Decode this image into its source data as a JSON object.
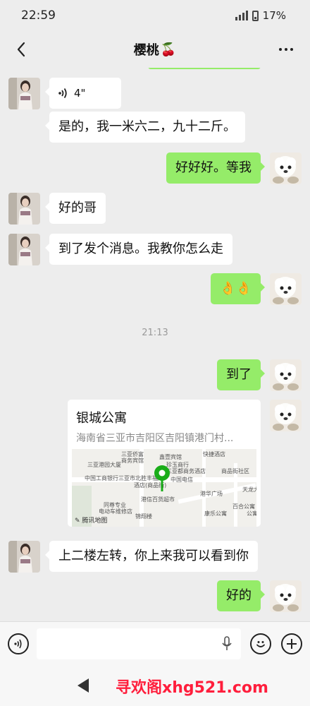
{
  "status": {
    "time": "22:59",
    "battery": "17%"
  },
  "nav": {
    "title": "樱桃",
    "title_emoji": "🍒"
  },
  "messages": {
    "voice_duration": "4\"",
    "m1": "是的，我一米六二，九十二斤。",
    "m2": "好好好。等我",
    "m3": "好的哥",
    "m4": "到了发个消息。我教你怎么走",
    "m5": "👌👌",
    "timestamp": "21:13",
    "m6": "到了",
    "m7": "上二楼左转，你上来我可以看到你",
    "m8": "好的"
  },
  "location": {
    "name": "银城公寓",
    "address": "海南省三亚市吉阳区吉阳镇港门村...",
    "map_labels": [
      "三亚侨富",
      "商务宾馆",
      "鑫壹宾馆",
      "快捷酒店",
      "三亚港园大厦",
      "珍玉商行",
      "三亚都商务酒店",
      "商品街社区",
      "中国工商银行",
      "三亚市北胜丰福库",
      "酒店(商品街)",
      "中国电信",
      "天龙大",
      "港华广场",
      "同尊专业",
      "电动车维修店",
      "港信百货超市",
      "百合公寓",
      "锦翔楼",
      "康乐公寓",
      "公寓"
    ],
    "map_source": "腾讯地图"
  },
  "watermark": "寻欢阁xhg521.com",
  "colors": {
    "sent_bubble": "#95ec69",
    "received_bubble": "#ffffff",
    "chat_bg": "#ededed",
    "pin": "#1aad19",
    "watermark": "#ff1e3c"
  },
  "icons": [
    "chevron-left-icon",
    "more-icon",
    "voice-wave-icon",
    "microphone-icon",
    "emoji-icon",
    "plus-icon",
    "back-icon",
    "map-pin-icon"
  ]
}
